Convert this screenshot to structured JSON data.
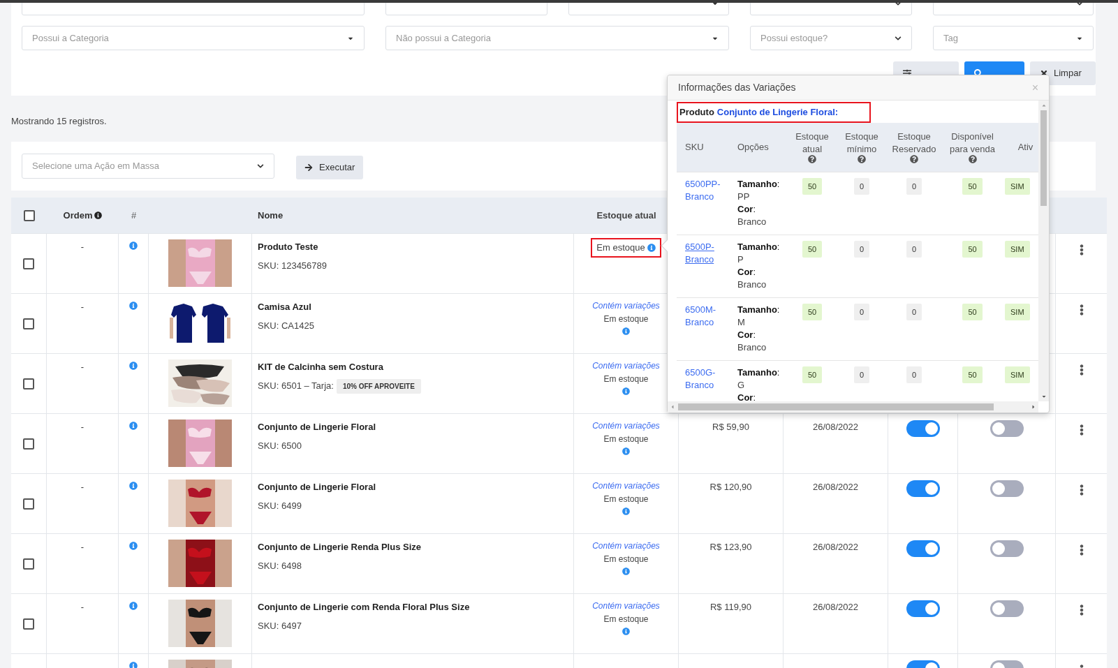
{
  "filters": {
    "row_1": [
      {
        "kind": "text"
      },
      {
        "kind": "text"
      },
      {
        "kind": "select"
      },
      {
        "kind": "native"
      },
      {
        "kind": "native"
      }
    ],
    "row_2": [
      {
        "kind": "select",
        "placeholder": "Possui a Categoria"
      },
      {
        "kind": "select",
        "placeholder": "Não possui a Categoria"
      },
      {
        "kind": "native",
        "placeholder": "Possui estoque?"
      },
      {
        "kind": "select",
        "placeholder": "Tag"
      }
    ],
    "buttons": [
      {
        "kind": "secondary"
      },
      {
        "kind": "primary"
      },
      {
        "kind": "secondary",
        "label": "Limpar"
      }
    ]
  },
  "record_count": "Mostrando 15 registros.",
  "mass_action": {
    "placeholder": "Selecione uma Ação em Massa",
    "button": "Executar"
  },
  "table": {
    "header_checked": false,
    "columns": [
      "Ordem",
      "#",
      "Nome",
      "Estoque atual"
    ],
    "rows": [
      {
        "checked": false,
        "order": "-",
        "name": "Produto Teste",
        "sku": "SKU: 123456789",
        "stock": {
          "kind": "simple",
          "status": "Em estoque",
          "highlighted": true
        }
      },
      {
        "checked": false,
        "order": "-",
        "name": "Camisa Azul",
        "sku": "SKU: CA1425",
        "stock": {
          "kind": "variations",
          "link": "Contém variações",
          "status": "Em estoque",
          "highlighted": false
        }
      },
      {
        "checked": false,
        "order": "-",
        "name": "KIT de Calcinha sem Costura",
        "sku": "SKU: 6501 – Tarja:",
        "tag": "10% OFF APROVEITE",
        "stock": {
          "kind": "variations",
          "link": "Contém variações",
          "status": "Em estoque",
          "highlighted": false
        }
      },
      {
        "checked": false,
        "order": "-",
        "name": "Conjunto de Lingerie Floral",
        "sku": "SKU: 6500",
        "stock": {
          "kind": "variations",
          "link": "Contém variações",
          "status": "Em estoque",
          "highlighted": false
        },
        "price": "R$ 59,90",
        "date": "26/08/2022",
        "toggles": [
          {
            "on": true
          },
          {
            "on": false
          }
        ]
      },
      {
        "checked": false,
        "order": "-",
        "name": "Conjunto de Lingerie Floral",
        "sku": "SKU: 6499",
        "stock": {
          "kind": "variations",
          "link": "Contém variações",
          "status": "Em estoque",
          "highlighted": false
        },
        "price": "R$ 120,90",
        "date": "26/08/2022",
        "toggles": [
          {
            "on": true
          },
          {
            "on": false
          }
        ]
      },
      {
        "checked": false,
        "order": "-",
        "name": "Conjunto de Lingerie Renda Plus Size",
        "sku": "SKU: 6498",
        "stock": {
          "kind": "variations",
          "link": "Contém variações",
          "status": "Em estoque",
          "highlighted": false
        },
        "price": "R$ 123,90",
        "date": "26/08/2022",
        "toggles": [
          {
            "on": true
          },
          {
            "on": false
          }
        ]
      },
      {
        "checked": false,
        "order": "-",
        "name": "Conjunto de Lingerie com Renda Floral Plus Size",
        "sku": "SKU: 6497",
        "stock": {
          "kind": "variations",
          "link": "Contém variações",
          "status": "Em estoque",
          "highlighted": false
        },
        "price": "R$ 119,90",
        "date": "26/08/2022",
        "toggles": [
          {
            "on": true
          },
          {
            "on": false
          }
        ]
      },
      {
        "toggles": [
          {
            "on": true
          },
          {
            "on": false
          }
        ]
      }
    ]
  },
  "popup": {
    "title": "Informações das Variações",
    "close": "×",
    "product_label": "Produto",
    "product_name": "Conjunto de Lingerie Floral:",
    "product_highlighted": true,
    "columns": [
      {
        "label": "SKU",
        "help": false
      },
      {
        "label": "Opções",
        "help": false
      },
      {
        "label": "Estoque atual",
        "help": true
      },
      {
        "label": "Estoque mínimo",
        "help": true
      },
      {
        "label": "Estoque Reservado",
        "help": true
      },
      {
        "label": "Disponível para venda",
        "help": true
      },
      {
        "label": "Ativ",
        "help": false
      }
    ],
    "rows": [
      {
        "sku": "6500PP-Branco",
        "hovered": false,
        "options": [
          {
            "label": "**Tamanho**:",
            "value": "PP"
          },
          {
            "label": "**Cor**:",
            "value": "Branco"
          }
        ],
        "stock": "50",
        "minimum": "0",
        "reserved": "0",
        "available": "50",
        "active": "SIM"
      },
      {
        "sku": "6500P-Branco",
        "hovered": true,
        "options": [
          {
            "label": "**Tamanho**:",
            "value": "P"
          },
          {
            "label": "**Cor**:",
            "value": "Branco"
          }
        ],
        "stock": "50",
        "minimum": "0",
        "reserved": "0",
        "available": "50",
        "active": "SIM"
      },
      {
        "sku": "6500M-Branco",
        "hovered": false,
        "options": [
          {
            "label": "**Tamanho**:",
            "value": "M"
          },
          {
            "label": "**Cor**:",
            "value": "Branco"
          }
        ],
        "stock": "50",
        "minimum": "0",
        "reserved": "0",
        "available": "50",
        "active": "SIM"
      },
      {
        "sku": "6500G-Branco",
        "hovered": false,
        "options": [
          {
            "label": "**Tamanho**:",
            "value": "G"
          },
          {
            "label": "**Cor**:"
          }
        ],
        "stock": "50",
        "minimum": "0",
        "reserved": "0",
        "available": "50",
        "active": "SIM"
      }
    ]
  }
}
